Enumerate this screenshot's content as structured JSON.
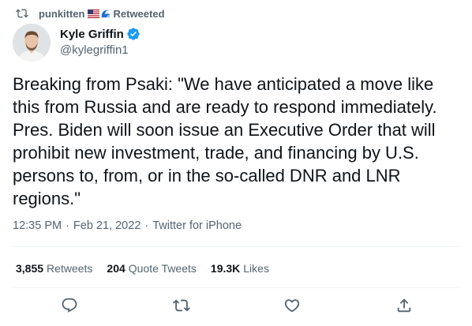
{
  "retweeter": {
    "name": "punkitten",
    "flag_icon": "us-flag-icon",
    "wave_icon": "wave-icon",
    "status": "Retweeted"
  },
  "author": {
    "name": "Kyle Griffin",
    "handle": "@kylegriffin1",
    "verified": true
  },
  "tweet": {
    "text": "Breaking from Psaki: \"We have anticipated a move like\nthis from Russia and are ready to respond immediately.\nPres. Biden will soon issue an Executive Order that will\nprohibit new investment, trade, and financing by U.S.\npersons to, from, or in the so-called DNR and LNR\nregions.\"",
    "time": "12:35 PM",
    "date": "Feb 21, 2022",
    "source": "Twitter for iPhone",
    "separator": "·"
  },
  "stats": {
    "retweets_count": "3,855",
    "retweets_label": "Retweets",
    "quotes_count": "204",
    "quotes_label": "Quote Tweets",
    "likes_count": "19.3K",
    "likes_label": "Likes"
  },
  "colors": {
    "text": "#0f1419",
    "secondary": "#536471",
    "verified": "#1d9bf0",
    "divider": "#eff3f4"
  }
}
